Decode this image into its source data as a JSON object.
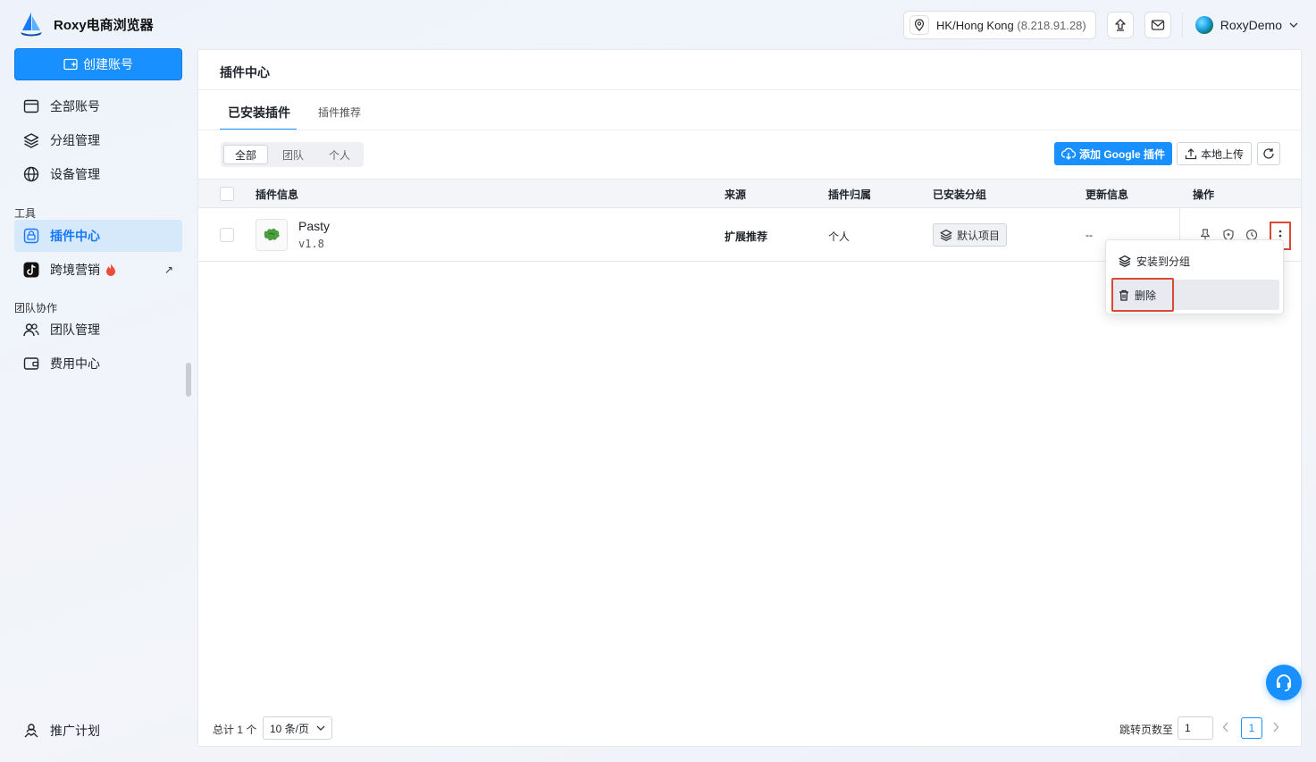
{
  "app": {
    "title": "Roxy电商浏览器"
  },
  "topbar": {
    "location": "HK/Hong Kong",
    "ip": "(8.218.91.28)",
    "username": "RoxyDemo"
  },
  "sidebar": {
    "create_label": "创建账号",
    "items_top": [
      {
        "label": "全部账号",
        "icon": "card-icon"
      },
      {
        "label": "分组管理",
        "icon": "layers-icon"
      },
      {
        "label": "设备管理",
        "icon": "globe-icon"
      }
    ],
    "section_tools": "工具",
    "items_tools": [
      {
        "label": "插件中心",
        "icon": "plugin-icon",
        "active": true
      },
      {
        "label": "跨境营销",
        "icon": "tiktok-icon"
      }
    ],
    "section_team": "团队协作",
    "items_team": [
      {
        "label": "团队管理",
        "icon": "users-icon"
      },
      {
        "label": "费用中心",
        "icon": "wallet-icon"
      }
    ],
    "promo_label": "推广计划"
  },
  "main": {
    "title": "插件中心",
    "tabs": [
      {
        "label": "已安装插件",
        "active": true
      },
      {
        "label": "插件推荐",
        "active": false
      }
    ],
    "filter": [
      {
        "label": "全部",
        "active": true
      },
      {
        "label": "团队",
        "active": false
      },
      {
        "label": "个人",
        "active": false
      }
    ],
    "add_google_label": "添加 Google 插件",
    "local_upload_label": "本地上传",
    "columns": [
      "插件信息",
      "来源",
      "插件归属",
      "已安装分组",
      "更新信息",
      "操作"
    ],
    "rows": [
      {
        "name": "Pasty",
        "version": "v1.8",
        "source": "扩展推荐",
        "owner": "个人",
        "group": "默认项目",
        "update": "--"
      }
    ],
    "dropdown": {
      "install_to_group": "安装到分组",
      "delete": "删除"
    },
    "footer": {
      "total": "总计 1 个",
      "page_size": "10 条/页",
      "jump_label": "跳转页数至",
      "jump_value": "1",
      "current_page": "1"
    }
  },
  "colors": {
    "accent": "#1890ff",
    "highlight_border": "#d94a35",
    "active_nav_bg": "#d6e9fb"
  }
}
